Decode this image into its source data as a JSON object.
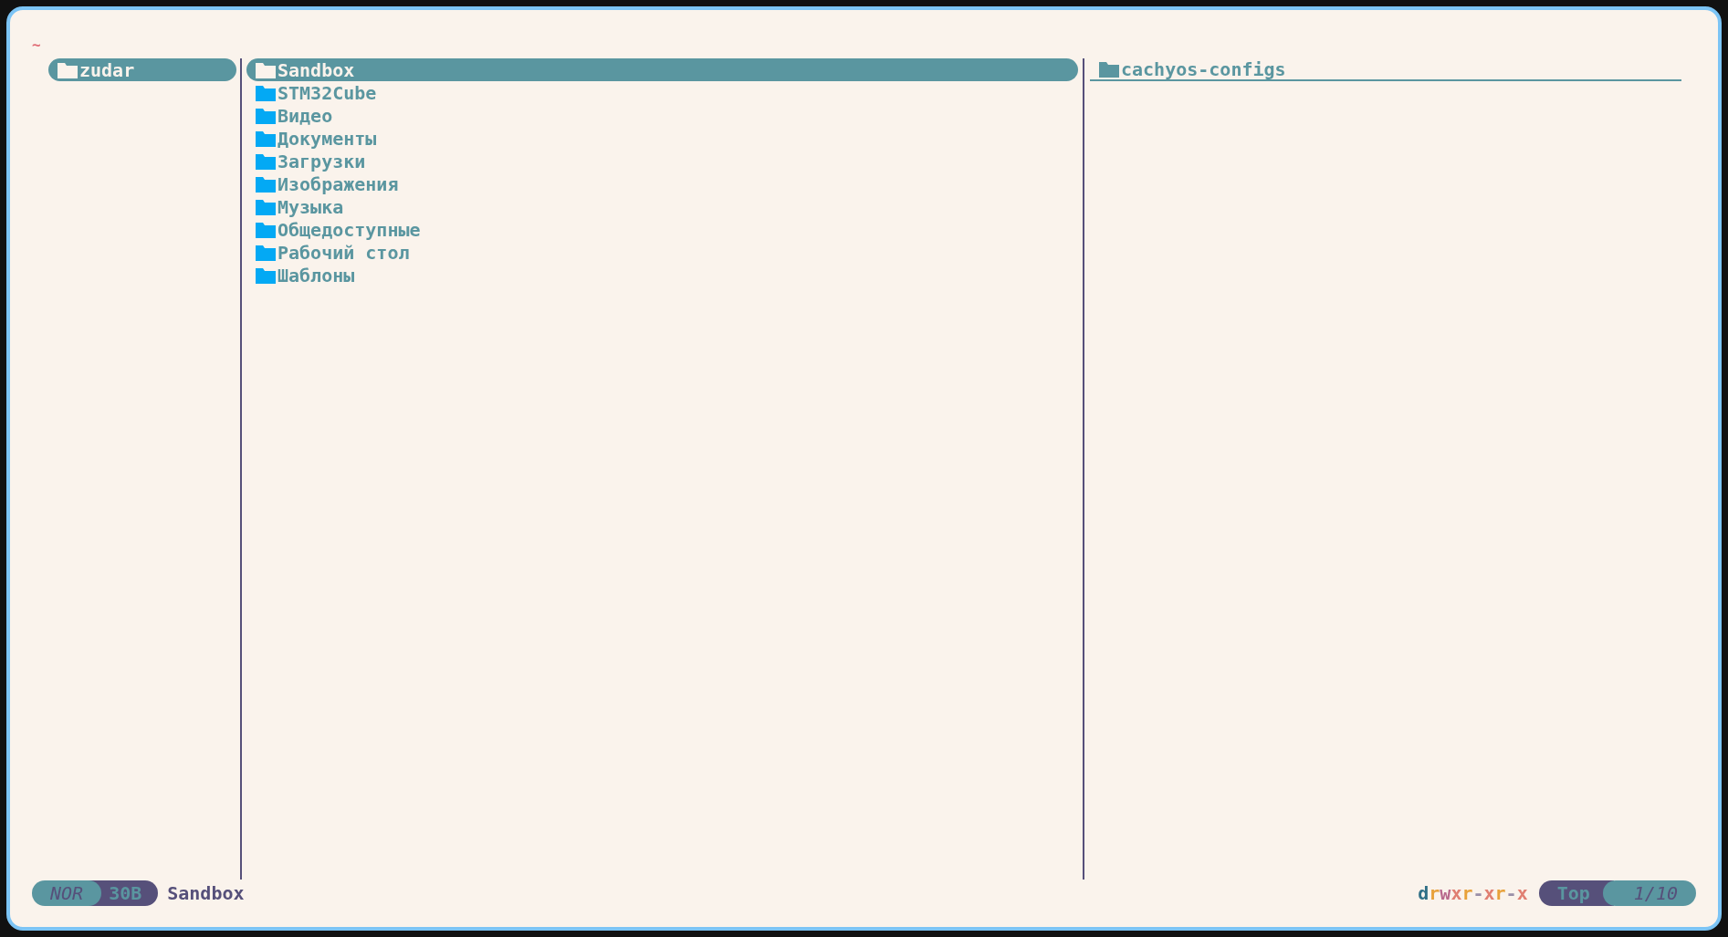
{
  "header": {
    "path": "~"
  },
  "parent": [
    {
      "name": "zudar",
      "selected": true
    }
  ],
  "current": [
    {
      "name": "Sandbox",
      "selected": true
    },
    {
      "name": "STM32Cube",
      "selected": false
    },
    {
      "name": "Видео",
      "selected": false
    },
    {
      "name": "Документы",
      "selected": false
    },
    {
      "name": "Загрузки",
      "selected": false
    },
    {
      "name": "Изображения",
      "selected": false
    },
    {
      "name": "Музыка",
      "selected": false
    },
    {
      "name": "Общедоступные",
      "selected": false
    },
    {
      "name": "Рабочий стол",
      "selected": false
    },
    {
      "name": "Шаблоны",
      "selected": false
    }
  ],
  "preview": [
    {
      "name": "cachyos-configs",
      "selected": true
    }
  ],
  "status_bar": {
    "mode": "NOR",
    "size": "30B",
    "name": "Sandbox",
    "permissions": [
      {
        "char": "d",
        "color": "#2f6f86"
      },
      {
        "char": "r",
        "color": "#e8a13a"
      },
      {
        "char": "w",
        "color": "#b8688c"
      },
      {
        "char": "x",
        "color": "#e07f72"
      },
      {
        "char": "r",
        "color": "#e8a13a"
      },
      {
        "char": "-",
        "color": "#9a8fa8"
      },
      {
        "char": "x",
        "color": "#e07f72"
      },
      {
        "char": "r",
        "color": "#e8a13a"
      },
      {
        "char": "-",
        "color": "#9a8fa8"
      },
      {
        "char": "x",
        "color": "#e07f72"
      }
    ],
    "position": "Top",
    "count": "1/10"
  }
}
